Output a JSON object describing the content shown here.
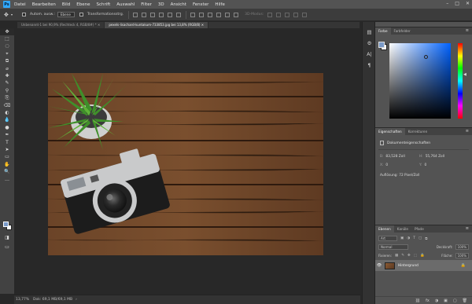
{
  "app": {
    "logo": "Ps"
  },
  "menu": [
    "Datei",
    "Bearbeiten",
    "Bild",
    "Ebene",
    "Schrift",
    "Auswahl",
    "Filter",
    "3D",
    "Ansicht",
    "Fenster",
    "Hilfe"
  ],
  "window_controls": [
    "–",
    "□",
    "✕"
  ],
  "options": {
    "auto_select_label": "Autom. ausw.:",
    "auto_select_value": "Ebene",
    "transform_label": "Transformationsstrg.",
    "mode_label": "3D-Modus:"
  },
  "tabs": [
    {
      "label": "Unbenannt-1 bei 90,9% (Rechteck 4, RGB/8#) *",
      "active": false
    },
    {
      "label": "pexels-lisachard-kuntakum-733853.jpg bei 13,8% (RGB/8)",
      "active": true
    }
  ],
  "tools": [
    "✥",
    "⬚",
    "◌",
    "⌖",
    "⧉",
    "⌀",
    "✚",
    "✎",
    "⚲",
    "⎘",
    "⌫",
    "◐",
    "💧",
    "●",
    "✒",
    "T",
    "➤",
    "▭",
    "✋",
    "🔍",
    "…"
  ],
  "status": {
    "zoom": "13,77%",
    "doc": "Dok: 69,1 MB/69,1 MB"
  },
  "right_strip_icons": [
    "▤",
    "⚙",
    "A|",
    "¶"
  ],
  "color_panel": {
    "tabs": [
      {
        "label": "Farbe",
        "active": true
      },
      {
        "label": "Farbfelder",
        "active": false
      }
    ],
    "menu": "≡",
    "fg_color": "#7a9ac8",
    "bg_color": "#ffffff"
  },
  "properties_panel": {
    "tabs": [
      {
        "label": "Eigenschaften",
        "active": true
      },
      {
        "label": "Korrekturen",
        "active": false
      }
    ],
    "menu": "≡",
    "heading": "Dokumenteigenschaften",
    "width_label": "B:",
    "width_value": "83,528 Zoll",
    "height_label": "H:",
    "height_value": "55,764 Zoll",
    "x_label": "X:",
    "x_value": "0",
    "y_label": "Y:",
    "y_value": "0",
    "resolution": "Auflösung: 72 Pixel/Zoll"
  },
  "layers_panel": {
    "tabs": [
      {
        "label": "Ebenen",
        "active": true
      },
      {
        "label": "Kanäle",
        "active": false
      },
      {
        "label": "Pfade",
        "active": false
      }
    ],
    "menu": "≡",
    "filter_label": "Art",
    "blend_mode": "Normal",
    "opacity_label": "Deckkraft:",
    "opacity_value": "100%",
    "lock_label": "Fixieren:",
    "fill_label": "Fläche:",
    "fill_value": "100%",
    "layer": {
      "name": "Hintergrund",
      "visible_icon": "👁",
      "lock_icon": "🔒"
    },
    "footer_icons": [
      "⛓",
      "fx",
      "◑",
      "▣",
      "▢",
      "🗑"
    ]
  },
  "colors": {
    "accent": "#31a8ff",
    "ui_dark": "#282828",
    "panel": "#535353"
  }
}
